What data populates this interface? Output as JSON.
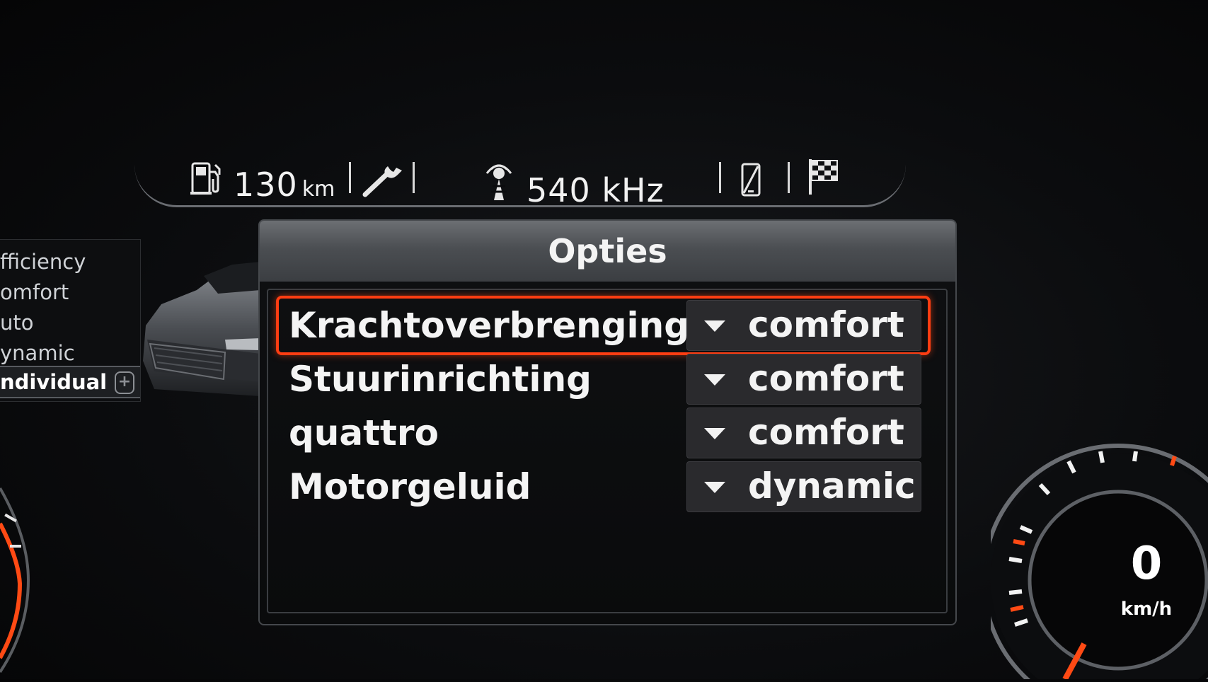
{
  "statusbar": {
    "range_value": "130",
    "range_unit": "km",
    "radio_frequency": "540 kHz",
    "icons": [
      "fuel-pump-icon",
      "wrench-icon",
      "radio-antenna-icon",
      "phone-icon",
      "checkered-flag-icon"
    ]
  },
  "drive_select": {
    "items": [
      {
        "label": "efficiency",
        "visible_text": "fficiency"
      },
      {
        "label": "comfort",
        "visible_text": "omfort"
      },
      {
        "label": "auto",
        "visible_text": "uto"
      },
      {
        "label": "dynamic",
        "visible_text": "ynamic"
      },
      {
        "label": "individual",
        "visible_text": "ndividual"
      }
    ],
    "active": "individual",
    "plus_badge": "+"
  },
  "options": {
    "title": "Opties",
    "rows": [
      {
        "label": "Krachtoverbrenging",
        "value": "comfort",
        "selected": true
      },
      {
        "label": "Stuurinrichting",
        "value": "comfort",
        "selected": false
      },
      {
        "label": "quattro",
        "value": "comfort",
        "selected": false
      },
      {
        "label": "Motorgeluid",
        "value": "dynamic",
        "selected": false
      }
    ]
  },
  "speedometer": {
    "speed": "0",
    "unit": "km/h"
  },
  "colors": {
    "accent": "#ff3d12",
    "panel_header": "#5a5d61",
    "background": "#0b0c0e"
  }
}
